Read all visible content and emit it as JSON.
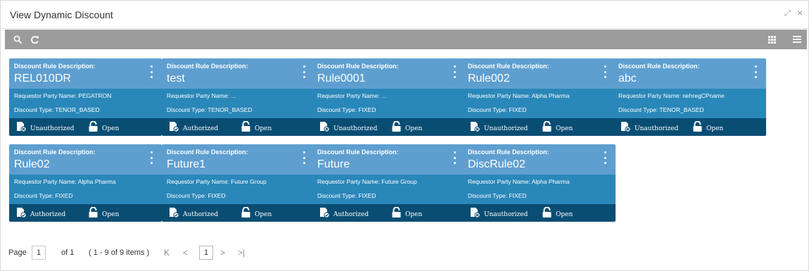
{
  "window": {
    "title": "View Dynamic Discount",
    "expand_glyph": "⤢",
    "close_glyph": "×"
  },
  "toolbar": {
    "icons": [
      "search-icon",
      "refresh-icon",
      "grid-view-icon",
      "list-view-icon"
    ]
  },
  "colors": {
    "card_header": "#5e9fd0",
    "card_body": "#2a87b9",
    "card_footer": "#0a4d73",
    "toolbar": "#9b9b9b"
  },
  "card_labels": {
    "description_label": "Discount Rule Description:",
    "party_label": "Requestor Party Name:",
    "type_label": "Discount Type:",
    "lock_label": "Open"
  },
  "cards": [
    {
      "description": "REL010DR",
      "party": "PEGATRON",
      "type": "TENOR_BASED",
      "status": "Unauthorized"
    },
    {
      "description": "test",
      "party": "...",
      "type": "TENOR_BASED",
      "status": "Authorized"
    },
    {
      "description": "Rule0001",
      "party": "...",
      "type": "FIXED",
      "status": "Unauthorized"
    },
    {
      "description": "Rule002",
      "party": "Alpha Pharma",
      "type": "FIXED",
      "status": "Unauthorized"
    },
    {
      "description": "abc",
      "party": "nehregCPname",
      "type": "TENOR_BASED",
      "status": "Unauthorized"
    },
    {
      "description": "Rule02",
      "party": "Alpha Pharma",
      "type": "FIXED",
      "status": "Authorized"
    },
    {
      "description": "Future1",
      "party": "Future Group",
      "type": "FIXED",
      "status": "Authorized"
    },
    {
      "description": "Future",
      "party": "Future Group",
      "type": "FIXED",
      "status": "Authorized"
    },
    {
      "description": "DiscRule02",
      "party": "Alpha Pharma",
      "type": "FIXED",
      "status": "Unauthorized"
    }
  ],
  "pagination": {
    "page_label": "Page",
    "current_page": "1",
    "of_label": "of 1",
    "items_summary": "( 1 - 9 of 9 items )",
    "first_glyph": "K",
    "prev_glyph": "<",
    "page_box": "1",
    "next_glyph": ">",
    "last_glyph": ">|"
  }
}
